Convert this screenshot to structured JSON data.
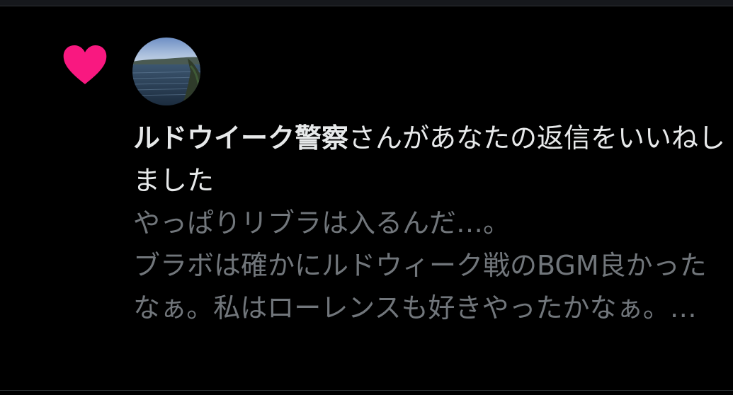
{
  "notification": {
    "type_icon": "heart-icon",
    "heart_color": "#f91880",
    "avatar_icon": "avatar-lake-photo",
    "username": "ルドウイーク警察",
    "action_text": "さんがあなたの返信をいいねしました",
    "tweet_text": "やっぱりリブラは入るんだ…。\nブラボは確かにルドウィーク戦のBGM良かったなぁ。私はローレンスも好きやったかなぁ。…"
  }
}
